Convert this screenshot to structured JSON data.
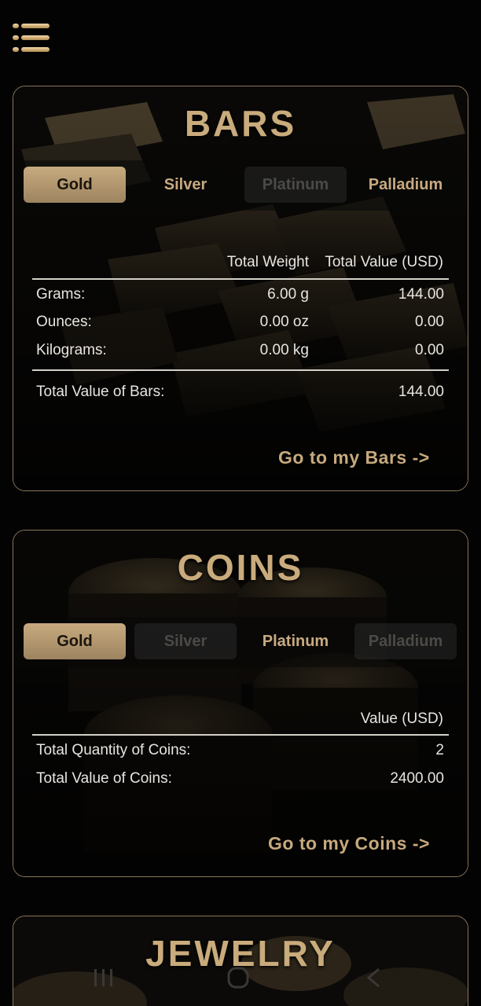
{
  "menu": {
    "icon": "hamburger-menu-icon"
  },
  "bars": {
    "title": "BARS",
    "tabs": [
      {
        "label": "Gold",
        "state": "active"
      },
      {
        "label": "Silver",
        "state": "normal"
      },
      {
        "label": "Platinum",
        "state": "disabled"
      },
      {
        "label": "Palladium",
        "state": "normal"
      }
    ],
    "col_weight": "Total Weight",
    "col_value": "Total Value (USD)",
    "rows": [
      {
        "unit": "Grams:",
        "weight": "6.00 g",
        "value": "144.00"
      },
      {
        "unit": "Ounces:",
        "weight": "0.00 oz",
        "value": "0.00"
      },
      {
        "unit": "Kilograms:",
        "weight": "0.00 kg",
        "value": "0.00"
      }
    ],
    "total_label": "Total Value of Bars:",
    "total_value": "144.00",
    "goto": "Go to my Bars ->"
  },
  "coins": {
    "title": "COINS",
    "tabs": [
      {
        "label": "Gold",
        "state": "active"
      },
      {
        "label": "Silver",
        "state": "disabled"
      },
      {
        "label": "Platinum",
        "state": "normal"
      },
      {
        "label": "Palladium",
        "state": "disabled"
      }
    ],
    "col_value": "Value (USD)",
    "quantity_label": "Total Quantity of Coins:",
    "quantity_value": "2",
    "total_label": "Total Value of Coins:",
    "total_value": "2400.00",
    "goto": "Go to my Coins ->"
  },
  "jewelry": {
    "title": "JEWELRY"
  },
  "system_nav": {
    "recents_icon": "recents-icon",
    "home_icon": "home-icon",
    "back_icon": "back-icon"
  },
  "colors": {
    "accent": "#c9ab7c",
    "background": "#030303",
    "border": "#8a7458"
  }
}
